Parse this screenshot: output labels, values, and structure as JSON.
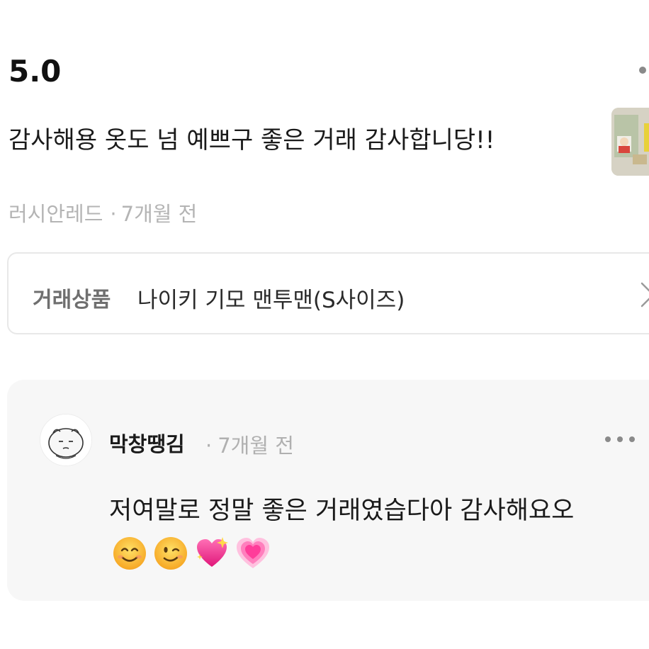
{
  "review": {
    "rating": "5.0",
    "text": "감사해용 옷도 넘 예쁘구 좋은 거래 감사합니당!!",
    "author": "러시안레드",
    "separator": "·",
    "time": "7개월 전"
  },
  "product": {
    "label": "거래상품",
    "name": "나이키 기모 맨투맨(S사이즈)"
  },
  "reply": {
    "author": "막창땡김",
    "separator": "·",
    "time": "7개월 전",
    "text": "저여말로 정말 좋은 거래였습다아 감사해요오",
    "emojis": [
      "smiling-face-icon",
      "winking-face-icon",
      "sparkling-heart-icon",
      "growing-heart-icon"
    ]
  },
  "colors": {
    "meta_gray": "#b4b4b4",
    "reply_background": "#f7f7f7",
    "border": "#e8e8e8"
  }
}
